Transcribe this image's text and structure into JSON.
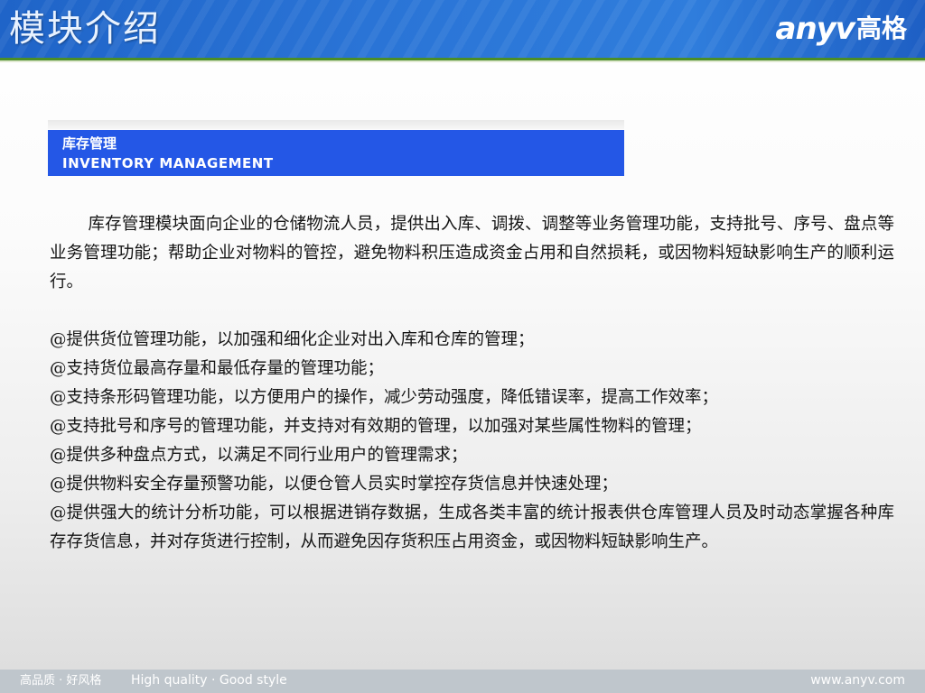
{
  "header": {
    "title": "模块介绍",
    "logo_mark": "anyv",
    "logo_cn": "高格"
  },
  "module": {
    "title_cn": "库存管理",
    "title_en": "INVENTORY  MANAGEMENT"
  },
  "content": {
    "intro": "库存管理模块面向企业的仓储物流人员，提供出入库、调拨、调整等业务管理功能，支持批号、序号、盘点等业务管理功能；帮助企业对物料的管控，避免物料积压造成资金占用和自然损耗，或因物料短缺影响生产的顺利运行。",
    "features": [
      "@提供货位管理功能，以加强和细化企业对出入库和仓库的管理；",
      "@支持货位最高存量和最低存量的管理功能；",
      "@支持条形码管理功能，以方便用户的操作，减少劳动强度，降低错误率，提高工作效率；",
      "@支持批号和序号的管理功能，并支持对有效期的管理，以加强对某些属性物料的管理；",
      "@提供多种盘点方式，以满足不同行业用户的管理需求；",
      "@提供物料安全存量预警功能，以便仓管人员实时掌控存货信息并快速处理；",
      "@提供强大的统计分析功能，可以根据进销存数据，生成各类丰富的统计报表供仓库管理人员及时动态掌握各种库存存货信息，并对存货进行控制，从而避免因存货积压占用资金，或因物料短缺影响生产。"
    ]
  },
  "footer": {
    "slogan_cn": "高品质 · 好风格",
    "slogan_en": "High quality · Good style",
    "url": "www.anyv.com"
  }
}
